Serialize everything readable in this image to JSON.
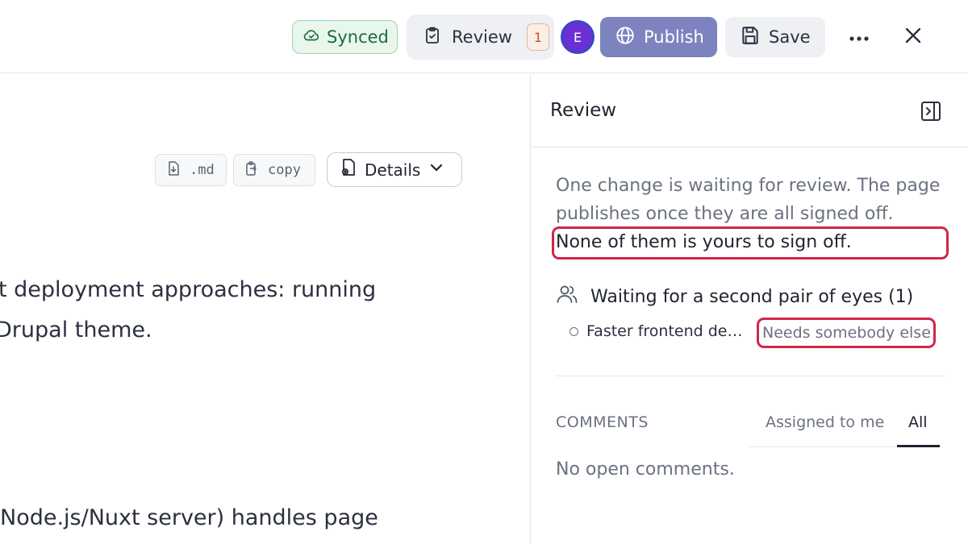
{
  "topbar": {
    "synced_label": "Synced",
    "review_label": "Review",
    "review_count": "1",
    "avatar_initial": "E",
    "publish_label": "Publish",
    "save_label": "Save"
  },
  "editor": {
    "md_chip": ".md",
    "copy_chip": "copy",
    "details_label": "Details",
    "lines": [
      "t deployment approaches: running",
      "Drupal theme.",
      "Node.js/Nuxt server) handles page"
    ]
  },
  "panel": {
    "title": "Review",
    "description": "One change is waiting for review. The page publishes once they are all signed off.",
    "description_strong": "None of them is yours to sign off.",
    "waiting_heading": "Waiting for a second pair of eyes (1)",
    "items": [
      {
        "title": "Faster frontend de…",
        "status": "Needs somebody else"
      }
    ],
    "comments_label": "COMMENTS",
    "tabs": [
      {
        "label": "Assigned to me"
      },
      {
        "label": "All"
      }
    ],
    "no_comments": "No open comments."
  },
  "colors": {
    "accent_publish": "#7c83bf",
    "synced_green": "#1e6b3b",
    "highlight_red": "#d0264a",
    "avatar_purple": "#6b2fd3"
  }
}
